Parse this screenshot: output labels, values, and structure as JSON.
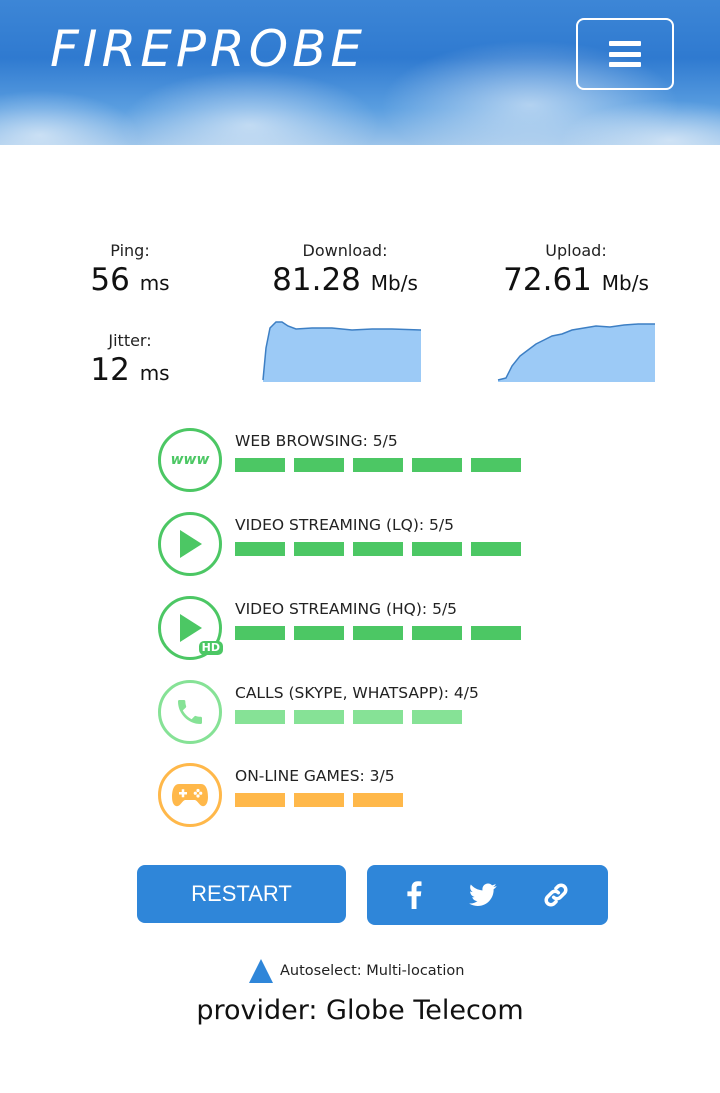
{
  "app": {
    "logo": "FIREPROBE"
  },
  "header": {
    "menu_icon": "hamburger-menu-icon"
  },
  "stats": {
    "ping": {
      "label": "Ping:",
      "value": "56",
      "unit": "ms"
    },
    "jitter": {
      "label": "Jitter:",
      "value": "12",
      "unit": "ms"
    },
    "download": {
      "label": "Download:",
      "value": "81.28",
      "unit": "Mb/s"
    },
    "upload": {
      "label": "Upload:",
      "value": "72.61",
      "unit": "Mb/s"
    }
  },
  "ratings": [
    {
      "title": "WEB BROWSING: 5/5",
      "score": 5,
      "max": 5,
      "icon": "www-icon",
      "color": "#4cc764"
    },
    {
      "title": "VIDEO STREAMING (LQ): 5/5",
      "score": 5,
      "max": 5,
      "icon": "play-icon",
      "color": "#4cc764"
    },
    {
      "title": "VIDEO STREAMING (HQ): 5/5",
      "score": 5,
      "max": 5,
      "icon": "play-hd-icon",
      "color": "#4cc764",
      "badge": "HD"
    },
    {
      "title": "CALLS (SKYPE, WHATSAPP): 4/5",
      "score": 4,
      "max": 5,
      "icon": "phone-icon",
      "color": "#86e296"
    },
    {
      "title": "ON-LINE GAMES: 3/5",
      "score": 3,
      "max": 5,
      "icon": "gamepad-icon",
      "color": "#ffb84a"
    }
  ],
  "actions": {
    "restart_label": "RESTART",
    "share_icons": [
      "facebook-icon",
      "twitter-icon",
      "link-icon"
    ]
  },
  "server": {
    "text": "Autoselect: Multi-location"
  },
  "provider": {
    "text": "provider: Globe Telecom"
  },
  "colors": {
    "accent": "#2f86d9",
    "graph_fill": "#9ccaf6",
    "graph_line": "#3d7fc4"
  }
}
